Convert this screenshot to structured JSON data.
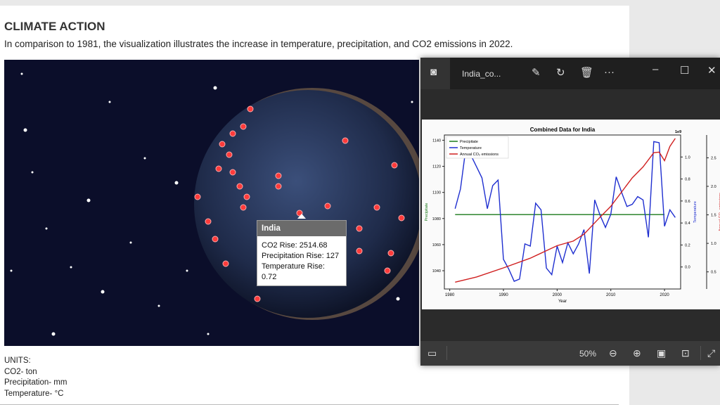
{
  "page": {
    "title": "CLIMATE ACTION",
    "subtitle": "In comparison to 1981, the visualization illustrates the increase in temperature, precipitation, and CO2 emissions in 2022.",
    "units": {
      "heading": "UNITS:",
      "co2": "CO2- ton",
      "precipitation": "Precipitation- mm",
      "temperature": "Temperature- °C"
    }
  },
  "tooltip": {
    "country": "India",
    "co2": "CO2 Rise: 2514.68",
    "precipitation": "Precipitation Rise: 127",
    "temperature": "Temperature Rise: 0.72"
  },
  "viewer": {
    "filename": "India_co...",
    "zoom": "50%",
    "icons": [
      "photos-app-icon",
      "edit-icon",
      "rotate-icon",
      "delete-icon",
      "more-icon",
      "minimize-icon",
      "maximize-icon",
      "close-icon",
      "filmstrip-icon",
      "zoom-out-icon",
      "zoom-in-icon",
      "fit-icon",
      "actual-size-icon",
      "fullscreen-icon"
    ]
  },
  "chart_data": {
    "type": "line",
    "title": "Combined Data for India",
    "xlabel": "Year",
    "ylabel_left": "Precipitate",
    "ylabel_right": "Temperature",
    "ylabel_right2": "Annual CO₂ emissions",
    "offset_label": "1e9",
    "legend_position": "top-left",
    "grid": false,
    "xlim": [
      1979,
      2023
    ],
    "xticks": [
      1980,
      1990,
      2000,
      2010,
      2020
    ],
    "ylim_left": [
      1026,
      1144
    ],
    "yticks_left": [
      1040,
      1060,
      1080,
      1100,
      1120,
      1140
    ],
    "ylim_right": [
      -0.2,
      1.2
    ],
    "yticks_right": [
      0.0,
      0.2,
      0.4,
      0.6,
      0.8,
      1.0
    ],
    "ylim_right2": [
      0.2,
      2.9
    ],
    "yticks_right2": [
      0.5,
      1.0,
      1.5,
      2.0,
      2.5
    ],
    "series": [
      {
        "name": "Precipitate",
        "axis": "left",
        "color": "#1a7a1a",
        "x": [
          1981,
          2020
        ],
        "y": [
          1083,
          1083
        ]
      },
      {
        "name": "Temperature",
        "axis": "right",
        "color": "#1f2fd0",
        "x": [
          1981,
          1982,
          1983,
          1984,
          1985,
          1986,
          1987,
          1988,
          1989,
          1990,
          1991,
          1992,
          1993,
          1994,
          1995,
          1996,
          1997,
          1998,
          1999,
          2000,
          2001,
          2002,
          2003,
          2004,
          2005,
          2006,
          2007,
          2008,
          2009,
          2010,
          2011,
          2012,
          2013,
          2014,
          2015,
          2016,
          2017,
          2018,
          2019,
          2020,
          2021,
          2022
        ],
        "y": [
          0.53,
          0.71,
          1.08,
          1.01,
          0.91,
          0.81,
          0.53,
          0.74,
          0.79,
          0.07,
          -0.02,
          -0.13,
          -0.11,
          0.21,
          0.19,
          0.58,
          0.52,
          -0.01,
          -0.07,
          0.19,
          0.04,
          0.22,
          0.12,
          0.21,
          0.34,
          -0.06,
          0.61,
          0.47,
          0.36,
          0.48,
          0.82,
          0.68,
          0.55,
          0.57,
          0.64,
          0.61,
          0.27,
          1.14,
          1.13,
          0.37,
          0.52,
          0.45
        ]
      },
      {
        "name": "Annual CO₂ emissions",
        "axis": "right2",
        "color": "#d02020",
        "x": [
          1981,
          1985,
          1990,
          1995,
          2000,
          2003,
          2005,
          2008,
          2010,
          2012,
          2014,
          2016,
          2018,
          2019,
          2020,
          2021,
          2022
        ],
        "y": [
          0.32,
          0.41,
          0.57,
          0.74,
          0.96,
          1.04,
          1.16,
          1.46,
          1.65,
          1.9,
          2.15,
          2.34,
          2.59,
          2.6,
          2.45,
          2.7,
          2.84
        ]
      }
    ]
  }
}
